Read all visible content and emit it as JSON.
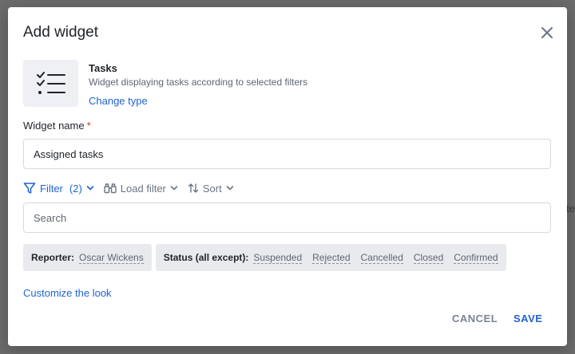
{
  "backdrop": {
    "fragment": "te"
  },
  "dialog": {
    "title": "Add widget",
    "close_icon": "close-icon",
    "widget_type": {
      "icon": "task-list-icon",
      "name": "Tasks",
      "description": "Widget displaying tasks according to selected filters",
      "change_link": "Change type"
    },
    "widget_name": {
      "label": "Widget name",
      "required_mark": "*",
      "value": "Assigned tasks"
    },
    "toolbar": {
      "filter_label": "Filter",
      "filter_count": "(2)",
      "load_filter_label": "Load filter",
      "sort_label": "Sort"
    },
    "search": {
      "placeholder": "Search"
    },
    "chips": {
      "reporter": {
        "label": "Reporter:",
        "values": [
          "Oscar Wickens"
        ]
      },
      "status": {
        "label": "Status (all except):",
        "values": [
          "Suspended",
          "Rejected",
          "Cancelled",
          "Closed",
          "Confirmed"
        ]
      }
    },
    "customize_link": "Customize the look",
    "buttons": {
      "cancel": "CANCEL",
      "save": "SAVE"
    }
  },
  "colors": {
    "accent": "#1e63d0",
    "required": "#d93025",
    "chip_bg": "#e8eaee",
    "muted": "#7b8390"
  }
}
